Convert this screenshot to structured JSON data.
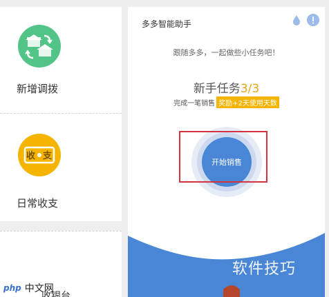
{
  "left_panel": {
    "tiles": [
      {
        "label": "新增调拨",
        "icon": "transfer-house-icon",
        "color": "#52c487"
      },
      {
        "label": "日常收支",
        "icon": "income-expense-icon",
        "color": "#f4b400"
      }
    ],
    "bottom_text": "收银台",
    "income_glyph": "收",
    "expense_glyph": "支"
  },
  "card": {
    "title": "多多智能助手",
    "subtitle": "跟随多多，一起做些小任务吧！",
    "task_heading": "新手任务",
    "task_progress": "3/3",
    "task_desc": "完成一笔销售",
    "reward": "奖励+2天使用天数",
    "start_button": "开始销售",
    "colors": {
      "accent": "#4a86d6",
      "reward": "#f4b400",
      "highlight": "#d4343e"
    }
  },
  "watermarks": {
    "right_text": "软件技巧",
    "left_php": "php",
    "left_cn": "中文网"
  }
}
